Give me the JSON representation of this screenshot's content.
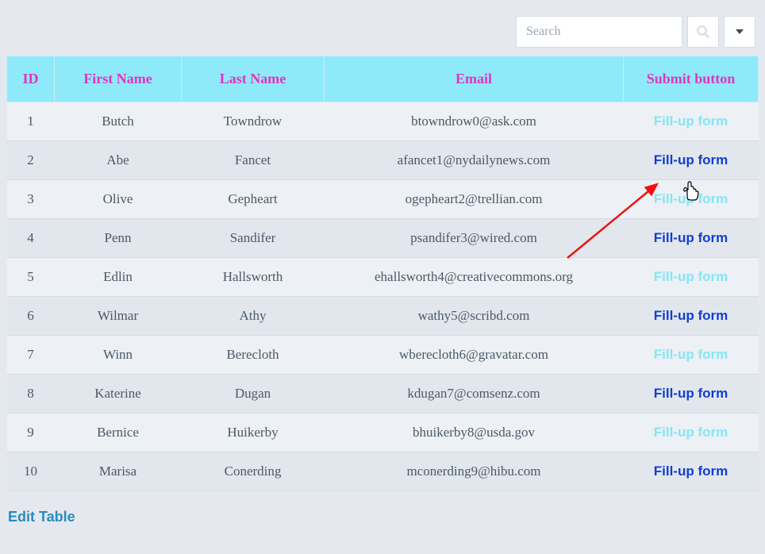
{
  "toolbar": {
    "search_placeholder": "Search"
  },
  "table": {
    "headers": {
      "id": "ID",
      "first_name": "First Name",
      "last_name": "Last Name",
      "email": "Email",
      "submit": "Submit button"
    },
    "action_label": "Fill-up form",
    "rows": [
      {
        "id": "1",
        "first_name": "Butch",
        "last_name": "Towndrow",
        "email": "btowndrow0@ask.com",
        "hovered": false
      },
      {
        "id": "2",
        "first_name": "Abe",
        "last_name": "Fancet",
        "email": "afancet1@nydailynews.com",
        "hovered": true
      },
      {
        "id": "3",
        "first_name": "Olive",
        "last_name": "Gepheart",
        "email": "ogepheart2@trellian.com",
        "hovered": false
      },
      {
        "id": "4",
        "first_name": "Penn",
        "last_name": "Sandifer",
        "email": "psandifer3@wired.com",
        "hovered": true
      },
      {
        "id": "5",
        "first_name": "Edlin",
        "last_name": "Hallsworth",
        "email": "ehallsworth4@creativecommons.org",
        "hovered": false
      },
      {
        "id": "6",
        "first_name": "Wilmar",
        "last_name": "Athy",
        "email": "wathy5@scribd.com",
        "hovered": true
      },
      {
        "id": "7",
        "first_name": "Winn",
        "last_name": "Berecloth",
        "email": "wberecloth6@gravatar.com",
        "hovered": false
      },
      {
        "id": "8",
        "first_name": "Katerine",
        "last_name": "Dugan",
        "email": "kdugan7@comsenz.com",
        "hovered": true
      },
      {
        "id": "9",
        "first_name": "Bernice",
        "last_name": "Huikerby",
        "email": "bhuikerby8@usda.gov",
        "hovered": false
      },
      {
        "id": "10",
        "first_name": "Marisa",
        "last_name": "Conerding",
        "email": "mconerding9@hibu.com",
        "hovered": true
      }
    ]
  },
  "footer": {
    "edit_label": "Edit Table"
  }
}
